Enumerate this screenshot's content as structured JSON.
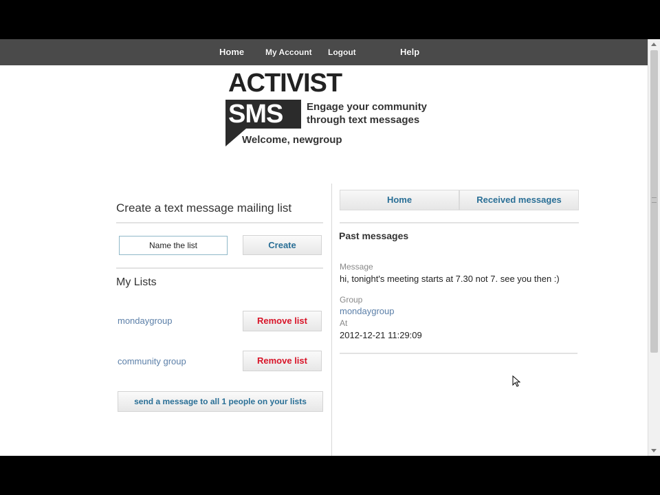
{
  "nav": {
    "home": "Home",
    "my_account": "My Account",
    "logout": "Logout",
    "help": "Help"
  },
  "logo": {
    "line1": "ACTIVIST",
    "line2": "SMS",
    "tagline1": "Engage your community",
    "tagline2": "through text messages"
  },
  "welcome": "Welcome, newgroup",
  "create": {
    "title": "Create a text message mailing list",
    "input_value": "Name the list",
    "button": "Create"
  },
  "my_lists": {
    "title": "My Lists",
    "items": [
      {
        "name": "mondaygroup",
        "button": "Remove list"
      },
      {
        "name": "community group",
        "button": "Remove list"
      }
    ],
    "send_button": "send a message to all 1 people on your lists"
  },
  "right_tabs": {
    "home": "Home",
    "received": "Received messages"
  },
  "past_messages": {
    "title": "Past messages",
    "message_label": "Message",
    "message_text": "hi, tonight's meeting starts at 7.30 not 7. see you then :)",
    "group_label": "Group",
    "group_value": "mondaygroup",
    "at_label": "At",
    "at_value": "2012-12-21 11:29:09"
  },
  "colors": {
    "nav_bar": "#4a4a4a",
    "link_blue": "#2a6f96",
    "remove_red": "#d81428",
    "list_link": "#5b7fa8"
  }
}
